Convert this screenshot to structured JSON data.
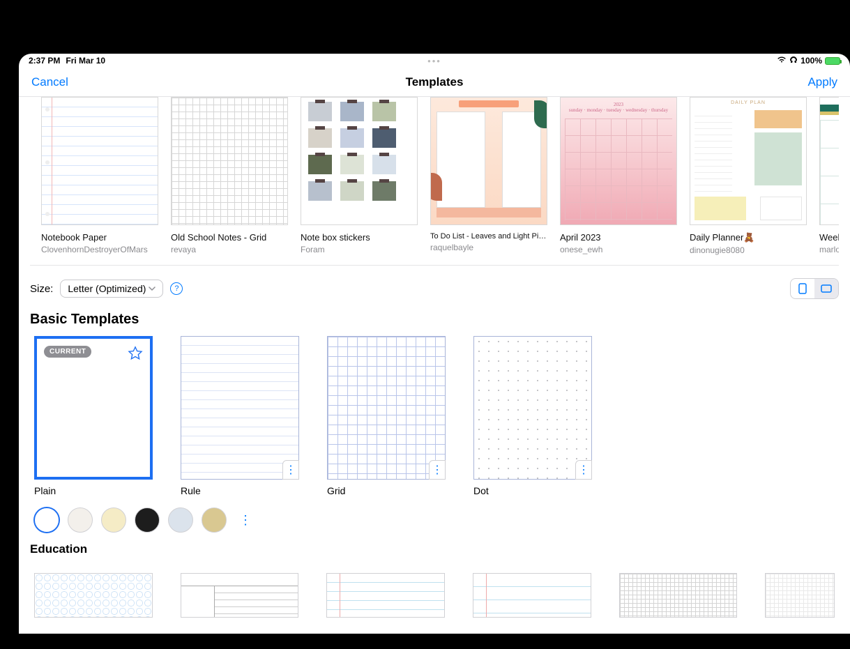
{
  "status": {
    "time": "2:37 PM",
    "date": "Fri Mar 10",
    "battery": "100%"
  },
  "header": {
    "cancel": "Cancel",
    "title": "Templates",
    "apply": "Apply"
  },
  "community": [
    {
      "name": "Notebook Paper",
      "author": "ClovenhornDestroyerOfMars"
    },
    {
      "name": "Old School Notes - Grid",
      "author": "revaya"
    },
    {
      "name": "Note box stickers",
      "author": "Foram"
    },
    {
      "name": "To Do List - Leaves and Light Pink Detail",
      "author": "raquelbayle"
    },
    {
      "name": "April 2023",
      "author": "onese_ewh"
    },
    {
      "name": "Daily Planner🧸",
      "author": "dinonugie8080"
    },
    {
      "name": "Weekly",
      "author": "marloesh"
    }
  ],
  "size": {
    "label": "Size:",
    "value": "Letter (Optimized)"
  },
  "basic": {
    "title": "Basic Templates",
    "items": [
      {
        "name": "Plain",
        "current_badge": "CURRENT"
      },
      {
        "name": "Rule"
      },
      {
        "name": "Grid"
      },
      {
        "name": "Dot"
      }
    ]
  },
  "colors": [
    "#ffffff",
    "#f3f0eb",
    "#f5ecc6",
    "#1d1d1d",
    "#dbe3ec",
    "#d9c891"
  ],
  "education": {
    "title": "Education"
  }
}
